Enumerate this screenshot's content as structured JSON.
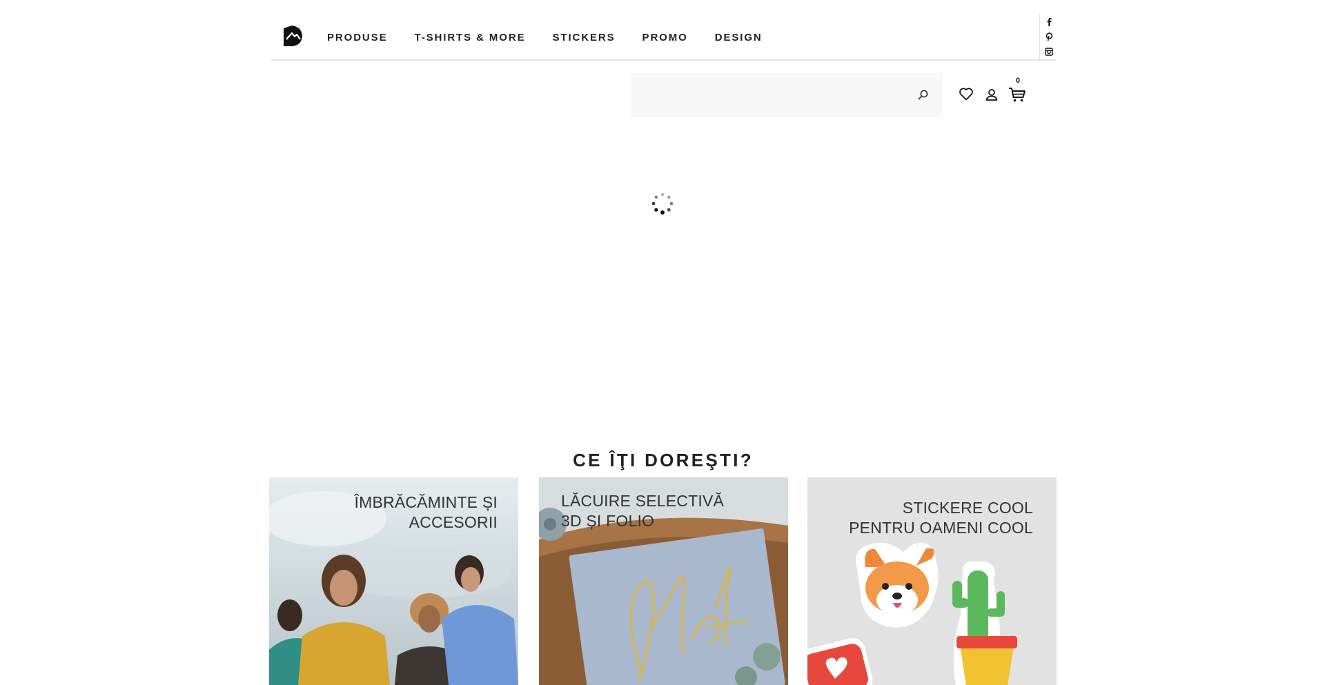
{
  "header": {
    "logo": "site-logo",
    "nav": [
      "PRODUSE",
      "T-SHIRTS & MORE",
      "STICKERS",
      "PROMO",
      "DESIGN"
    ],
    "social": [
      "facebook-icon",
      "pinterest-icon",
      "instagram-icon"
    ]
  },
  "search": {
    "placeholder": "",
    "value": ""
  },
  "actions": {
    "cart_count": "0"
  },
  "section": {
    "title": "CE ÎŢI DOREŞTI?"
  },
  "cards": [
    {
      "title": "ÎMBRĂCĂMINTE ȘI\nACCESORII",
      "background": "#c9d3d8"
    },
    {
      "title": "LĂCUIRE SELECTIVĂ\n3D ȘI FOLIO",
      "background": "#c1cad6"
    },
    {
      "title": "STICKERE COOL\nPENTRU OAMENI COOL",
      "background": "#e2e2e2"
    }
  ],
  "colors": {
    "accent_text": "#222222",
    "search_bg": "#f7f7f7",
    "divider": "#e6e6e6"
  }
}
